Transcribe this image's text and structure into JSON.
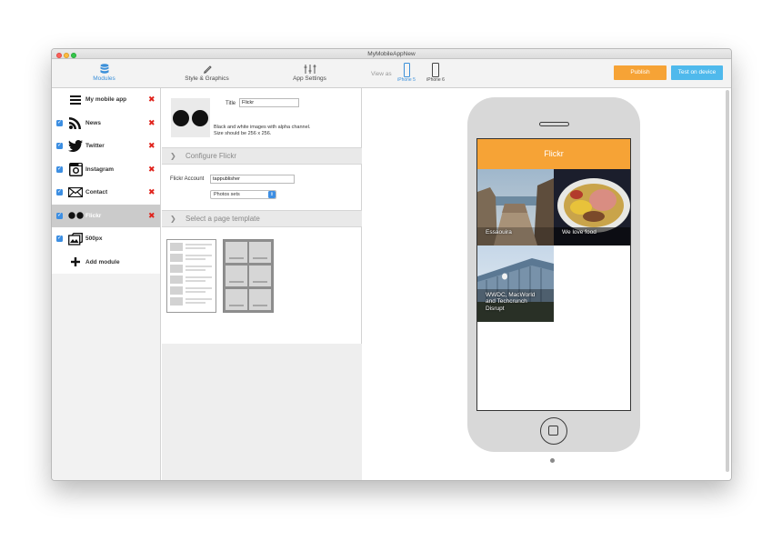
{
  "window": {
    "title": "MyMobileAppNew"
  },
  "toolbar": {
    "tabs": [
      {
        "label": "Modules",
        "icon": "database-icon",
        "active": true
      },
      {
        "label": "Style & Graphics",
        "icon": "brush-icon",
        "active": false
      },
      {
        "label": "App Settings",
        "icon": "sliders-icon",
        "active": false
      }
    ],
    "view_as": "View as",
    "devices": [
      {
        "label": "iPhone 5",
        "active": true
      },
      {
        "label": "iPhone 6",
        "active": false
      }
    ],
    "publish_label": "Publish",
    "test_label": "Test on device"
  },
  "sidebar": {
    "items": [
      {
        "label": "My mobile app",
        "icon": "menu-icon",
        "checkbox": false,
        "delete": true,
        "selected": false
      },
      {
        "label": "News",
        "icon": "rss-icon",
        "checkbox": true,
        "delete": true,
        "selected": false
      },
      {
        "label": "Twitter",
        "icon": "twitter-bird-icon",
        "checkbox": true,
        "delete": true,
        "selected": false
      },
      {
        "label": "Instagram",
        "icon": "instagram-icon",
        "checkbox": true,
        "delete": true,
        "selected": false
      },
      {
        "label": "Contact",
        "icon": "envelope-icon",
        "checkbox": true,
        "delete": true,
        "selected": false
      },
      {
        "label": "Flickr",
        "icon": "flickr-dots-icon",
        "checkbox": true,
        "delete": true,
        "selected": true
      },
      {
        "label": "500px",
        "icon": "500px-icon",
        "checkbox": true,
        "delete": false,
        "selected": false
      }
    ],
    "add_label": "Add module"
  },
  "editor": {
    "title_label": "Title",
    "title_value": "Flickr",
    "icon_hint_line1": "Black and white images with alpha channel.",
    "icon_hint_line2": "Size should be 256 x 256.",
    "configure_header": "Configure Flickr",
    "account_label": "Flickr Account",
    "account_value": "tappublisher",
    "select_value": "Photos sets",
    "template_header": "Select a page template"
  },
  "preview": {
    "app_title": "Flickr",
    "tiles": [
      {
        "caption_lines": [
          "Essaouira"
        ]
      },
      {
        "caption_lines": [
          "We love food"
        ]
      },
      {
        "caption_lines": [
          "WWDC, MacWorld",
          "and Techcrunch",
          "Disrupt"
        ]
      }
    ]
  },
  "colors": {
    "accent": "#f6a336",
    "blue": "#4fb9ec",
    "active_tab": "#3a8fd9",
    "delete": "#e0221b"
  }
}
